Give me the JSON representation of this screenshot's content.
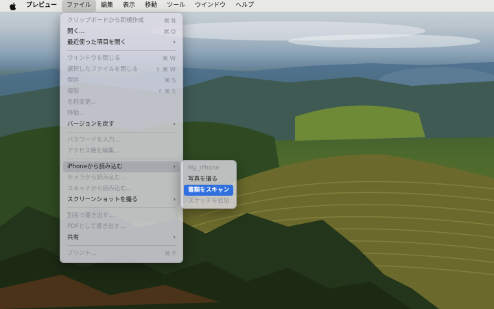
{
  "menubar": {
    "apple_icon": "apple-logo-icon",
    "app_name": "プレビュー",
    "items": [
      "ファイル",
      "編集",
      "表示",
      "移動",
      "ツール",
      "ウインドウ",
      "ヘルプ"
    ]
  },
  "file_menu": {
    "groups": [
      [
        {
          "label": "クリップボードから新規作成",
          "shortcut": "⌘ N",
          "enabled": false
        },
        {
          "label": "開く...",
          "shortcut": "⌘ O",
          "enabled": true
        },
        {
          "label": "最近使った項目を開く",
          "submenu": true,
          "enabled": true
        }
      ],
      [
        {
          "label": "ウインドウを閉じる",
          "shortcut": "⌘ W",
          "enabled": false
        },
        {
          "label": "選択したファイルを閉じる",
          "shortcut": "⇧ ⌘ W",
          "enabled": false
        },
        {
          "label": "保存",
          "shortcut": "⌘ S",
          "enabled": false
        },
        {
          "label": "複製",
          "shortcut": "⇧ ⌘ S",
          "enabled": false
        },
        {
          "label": "名称変更...",
          "enabled": false
        },
        {
          "label": "移動...",
          "enabled": false
        },
        {
          "label": "バージョンを戻す",
          "submenu": true,
          "enabled": true
        }
      ],
      [
        {
          "label": "パスワードを入力...",
          "enabled": false
        },
        {
          "label": "アクセス権を編集...",
          "enabled": false
        }
      ],
      [
        {
          "label": "iPhoneから読み込む",
          "submenu": true,
          "enabled": true,
          "highlighted": true
        },
        {
          "label": "カメラから読み込む...",
          "enabled": false
        },
        {
          "label": "スキャナから読み込む...",
          "enabled": false
        },
        {
          "label": "スクリーンショットを撮る",
          "submenu": true,
          "enabled": true
        }
      ],
      [
        {
          "label": "別名で書き出す...",
          "enabled": false
        },
        {
          "label": "PDFとして書き出す...",
          "enabled": false
        },
        {
          "label": "共有",
          "submenu": true,
          "enabled": true
        }
      ],
      [
        {
          "label": "プリント...",
          "shortcut": "⌘ P",
          "enabled": false
        }
      ]
    ]
  },
  "iphone_submenu": {
    "items": [
      {
        "label": "My_iPhone",
        "enabled": false
      },
      {
        "label": "写真を撮る",
        "enabled": true
      },
      {
        "label": "書類をスキャン",
        "enabled": true,
        "selected": true
      },
      {
        "label": "スケッチを追加",
        "enabled": false
      }
    ]
  }
}
